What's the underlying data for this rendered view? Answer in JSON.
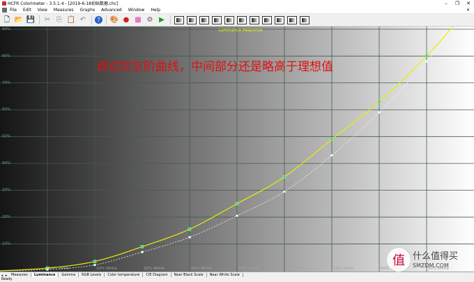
{
  "window": {
    "title": "HCFR Colorimeter - 3.5.1.4 - [2019-6-18初始数据.chc]",
    "min_glyph": "–",
    "max_glyph": "❐",
    "close_glyph": "✕"
  },
  "menu": {
    "items": [
      "File",
      "Edit",
      "View",
      "Measures",
      "Graphs",
      "Advanced",
      "Window",
      "Help"
    ],
    "right_glyph": "✕"
  },
  "toolbar": {
    "icons": [
      "new-icon",
      "open-icon",
      "save-icon",
      "cut-icon",
      "copy-icon",
      "paste-icon",
      "undo-icon",
      "help-icon",
      "palette-icon",
      "rgb-dots-icon",
      "color-swatch-icon",
      "gear-icon",
      "play-icon"
    ],
    "glyphs": [
      "🗋",
      "📂",
      "💾",
      "✂",
      "⎘",
      "📋",
      "↶",
      "?",
      "🎨",
      "●",
      "▦",
      "⚙",
      "▶"
    ],
    "colors": [
      "#ffffff",
      "#e8b800",
      "#3a5fb0",
      "#888",
      "#888",
      "#888",
      "#888",
      "#2962c8",
      "#c03030",
      "#d02020",
      "#e040a0",
      "#606060",
      "#1a9a1a"
    ]
  },
  "chart_data": {
    "type": "line",
    "title": "Luminance Response",
    "annotation": "调试完灰阶曲线，中间部分还是略高于理想值",
    "x": [
      0,
      10,
      20,
      30,
      40,
      50,
      60,
      70,
      80,
      90,
      100
    ],
    "x_tick_labels": [
      "",
      "10% White",
      "20% White",
      "30% White",
      "40% White",
      "50% White",
      "60% White",
      "70% White",
      "80% White",
      "90% White",
      ""
    ],
    "y_tick_labels": [
      "10%",
      "20%",
      "30%",
      "40%",
      "50%",
      "60%",
      "70%",
      "80%",
      "90%"
    ],
    "ylim": [
      0,
      91
    ],
    "series": [
      {
        "values": [
          0,
          1,
          3.5,
          9,
          15.5,
          25,
          35,
          49,
          63,
          80,
          100
        ],
        "color": "#e8f000"
      },
      {
        "values": [
          0,
          0.5,
          2.2,
          7,
          12.5,
          20.5,
          29.5,
          43,
          59,
          78,
          100
        ],
        "color": "#f4f4f4"
      }
    ],
    "grid": true,
    "background": "gradient dark to white",
    "annotation_color": "#e01010",
    "title_color": "#e8f000"
  },
  "tabs": {
    "nav_glyphs": [
      "◂",
      "▸"
    ],
    "items": [
      "Measures",
      "Luminance",
      "Gamma",
      "RGB Levels",
      "Color temperature",
      "CIE Diagram",
      "Near Black Scale",
      "Near White Scale"
    ],
    "active": "Luminance"
  },
  "status": {
    "text": "Ready"
  },
  "watermark": {
    "circle_glyph": "值",
    "text": "什么值得买",
    "sub": "SMZDM.COM"
  }
}
